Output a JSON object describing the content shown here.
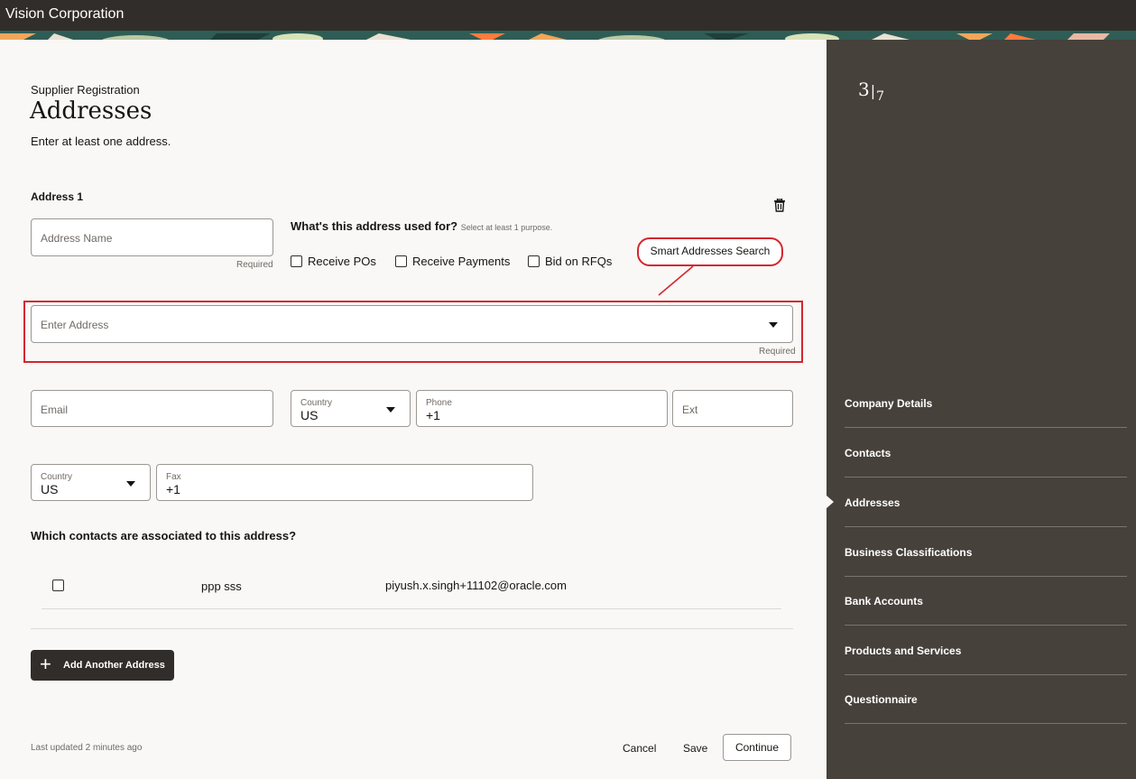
{
  "header": {
    "app_title": "Vision Corporation"
  },
  "page": {
    "breadcrumb": "Supplier Registration",
    "title": "Addresses",
    "intro": "Enter at least one address."
  },
  "address": {
    "label": "Address 1",
    "name_placeholder": "Address Name",
    "required": "Required",
    "purpose_question": "What's this address used for?",
    "purpose_hint": "Select at least 1 purpose.",
    "purposes": [
      {
        "label": "Receive POs",
        "checked": false
      },
      {
        "label": "Receive Payments",
        "checked": false
      },
      {
        "label": "Bid on RFQs",
        "checked": false
      }
    ],
    "callout": "Smart Addresses Search",
    "enter_address_placeholder": "Enter Address",
    "email_placeholder": "Email",
    "phone": {
      "country_label": "Country",
      "country_value": "US",
      "phone_label": "Phone",
      "phone_value": "+1",
      "ext_placeholder": "Ext"
    },
    "fax": {
      "country_label": "Country",
      "country_value": "US",
      "fax_label": "Fax",
      "fax_value": "+1"
    },
    "contacts_question": "Which contacts are associated to this address?",
    "contacts": [
      {
        "name": "ppp sss",
        "email": "piyush.x.singh+11102@oracle.com",
        "checked": false
      }
    ]
  },
  "actions": {
    "add_another": "Add Another Address",
    "last_updated": "Last updated 2 minutes ago",
    "cancel": "Cancel",
    "save": "Save",
    "continue": "Continue"
  },
  "progress": {
    "current": "3",
    "total": "7"
  },
  "nav": {
    "current": "Addresses",
    "items": [
      "Company Details",
      "Contacts",
      "Addresses",
      "Business Classifications",
      "Bank Accounts",
      "Products and Services",
      "Questionnaire"
    ]
  },
  "colors": {
    "topbar": "#312d2a",
    "sidebar": "#46413b",
    "highlight": "#d5262f",
    "button_dark": "#312d2a"
  },
  "icons": {
    "delete": "trash-icon",
    "dropdown": "caret-down-icon",
    "add": "plus-icon"
  }
}
